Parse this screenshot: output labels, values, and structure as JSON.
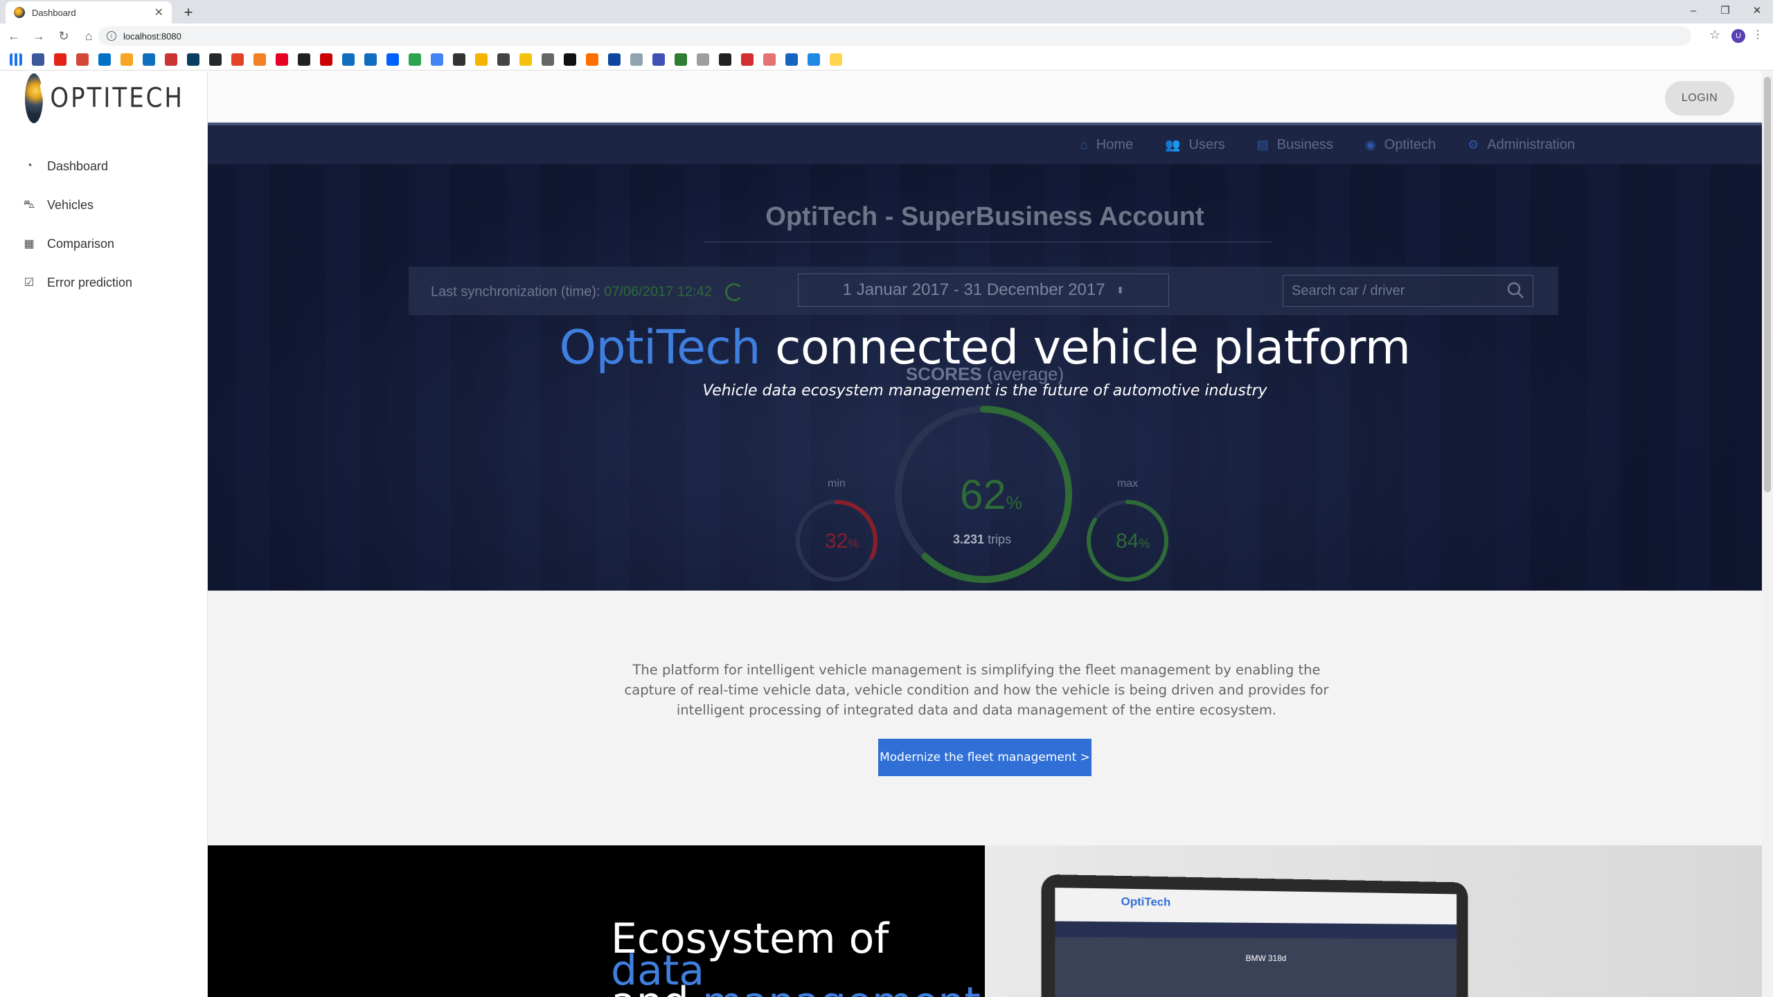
{
  "browser": {
    "tab_title": "Dashboard",
    "url": "localhost:8080",
    "profile_initial": "U"
  },
  "sidebar": {
    "logo_text": "OPTITECH",
    "items": [
      {
        "label": "Dashboard",
        "icon": "dashboard-icon"
      },
      {
        "label": "Vehicles",
        "icon": "car-icon"
      },
      {
        "label": "Comparison",
        "icon": "table-icon"
      },
      {
        "label": "Error prediction",
        "icon": "checkbox-icon"
      }
    ]
  },
  "header": {
    "login_label": "LOGIN"
  },
  "topnav": {
    "items": [
      {
        "label": "Home",
        "icon": "home-icon"
      },
      {
        "label": "Users",
        "icon": "users-icon"
      },
      {
        "label": "Business",
        "icon": "business-icon"
      },
      {
        "label": "Optitech",
        "icon": "optitech-icon"
      },
      {
        "label": "Administration",
        "icon": "cogs-icon"
      }
    ]
  },
  "dashboard": {
    "account_title": "OptiTech - SuperBusiness Account",
    "sync_label": "Last synchronization (time):",
    "sync_time": "07/06/2017 12:42",
    "date_range": "1 Januar 2017 - 31 December 2017",
    "search_placeholder": "Search car / driver",
    "scores_label": "SCORES",
    "scores_sub": "(average)",
    "gauge_main": {
      "value": "62",
      "unit": "%",
      "trips_count": "3.231",
      "trips_label": "trips",
      "fraction": 0.62,
      "color": "#2e6b36"
    },
    "gauge_min": {
      "label": "min",
      "value": "32",
      "unit": "%",
      "fraction": 0.32,
      "color": "#8a1f2c"
    },
    "gauge_max": {
      "label": "max",
      "value": "84",
      "unit": "%",
      "fraction": 0.84,
      "color": "#2e6b36"
    }
  },
  "hero": {
    "title_brand": "OptiTech",
    "title_rest": " connected vehicle platform",
    "subtitle": "Vehicle data ecosystem management is the future of automotive industry"
  },
  "intro": {
    "text": "The platform for intelligent vehicle management is simplifying the fleet management by enabling the capture of real-time vehicle data, vehicle condition and how the vehicle is being driven and provides for intelligent processing of integrated data and data management of the entire ecosystem.",
    "cta_label": "Modernize the fleet management >"
  },
  "ecosystem": {
    "line1_a": "Ecosystem of ",
    "line1_b": "data",
    "line2_a": "and ",
    "line2_b": "management",
    "laptop_logo": "OptiTech",
    "laptop_car": "BMW 318d"
  },
  "colors": {
    "accent": "#3f7fe0",
    "cta": "#2f6fd6",
    "hero_bg": "#121a33"
  }
}
